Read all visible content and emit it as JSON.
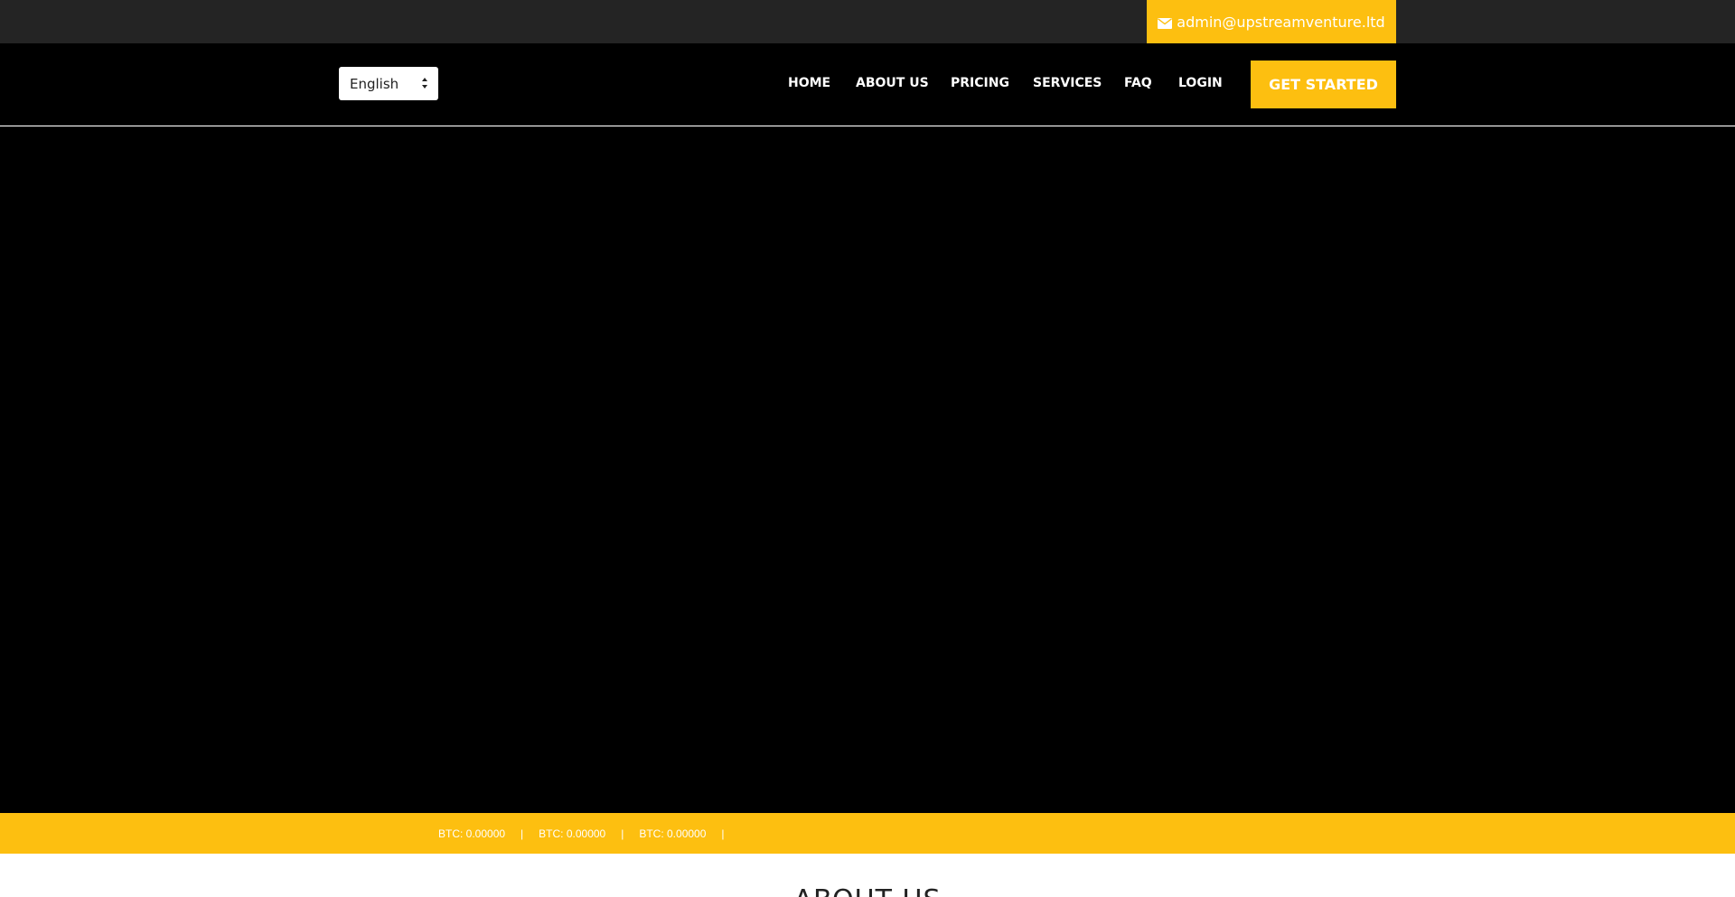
{
  "topbar": {
    "email": "admin@upstreamventure.ltd",
    "email_icon": "envelope-icon",
    "accent_color": "#fdbf10"
  },
  "header": {
    "language_selected": "English",
    "nav": [
      "HOME",
      "ABOUT US",
      "PRICING",
      "SERVICES",
      "FAQ",
      "LOGIN"
    ],
    "cta_label": "GET STARTED"
  },
  "ticker": {
    "items": [
      "BTC: 0.00000",
      "BTC: 0.00000",
      "BTC: 0.00000"
    ],
    "separator": "|"
  },
  "about": {
    "heading": "ABOUT US"
  }
}
